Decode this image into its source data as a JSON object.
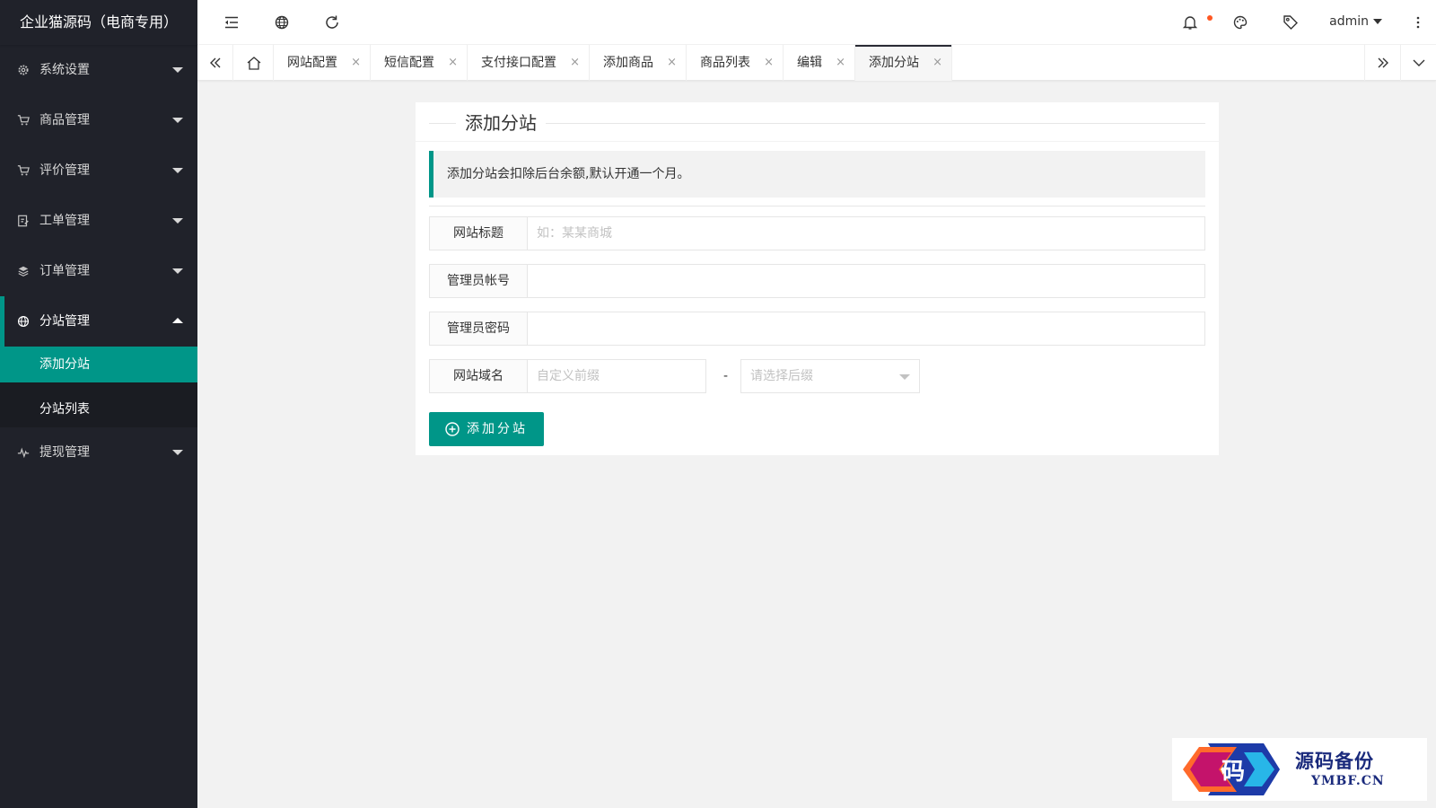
{
  "app": {
    "title": "企业猫源码（电商专用）"
  },
  "sidebar": {
    "items": [
      {
        "label": "系统设置",
        "icon": "gear-icon"
      },
      {
        "label": "商品管理",
        "icon": "cart-icon"
      },
      {
        "label": "评价管理",
        "icon": "cart-icon"
      },
      {
        "label": "工单管理",
        "icon": "ticket-icon"
      },
      {
        "label": "订单管理",
        "icon": "layers-icon"
      },
      {
        "label": "分站管理",
        "icon": "globe-icon",
        "open": true,
        "children": [
          {
            "label": "添加分站",
            "active": true
          },
          {
            "label": "分站列表"
          }
        ]
      },
      {
        "label": "提现管理",
        "icon": "pulse-icon"
      }
    ]
  },
  "header": {
    "user": "admin"
  },
  "tabs": [
    {
      "label": "网站配置"
    },
    {
      "label": "短信配置"
    },
    {
      "label": "支付接口配置"
    },
    {
      "label": "添加商品"
    },
    {
      "label": "商品列表"
    },
    {
      "label": "编辑"
    },
    {
      "label": "添加分站",
      "active": true
    }
  ],
  "tab_close": "×",
  "form": {
    "title": "添加分站",
    "notice": "添加分站会扣除后台余额,默认开通一个月。",
    "site_title": {
      "label": "网站标题",
      "placeholder": "如：某某商城",
      "value": ""
    },
    "admin_account": {
      "label": "管理员帐号",
      "placeholder": "",
      "value": ""
    },
    "admin_password": {
      "label": "管理员密码",
      "placeholder": "",
      "value": ""
    },
    "domain": {
      "label": "网站域名",
      "prefix_placeholder": "自定义前缀",
      "separator": "-",
      "suffix_placeholder": "请选择后缀"
    },
    "submit_label": "添加分站"
  },
  "watermark": {
    "name": "源码备份",
    "domain": "YMBF.CN",
    "glyph": "码"
  },
  "colors": {
    "accent": "#009688",
    "sidebar_bg": "#20222a",
    "notify_dot": "#ff5722"
  }
}
